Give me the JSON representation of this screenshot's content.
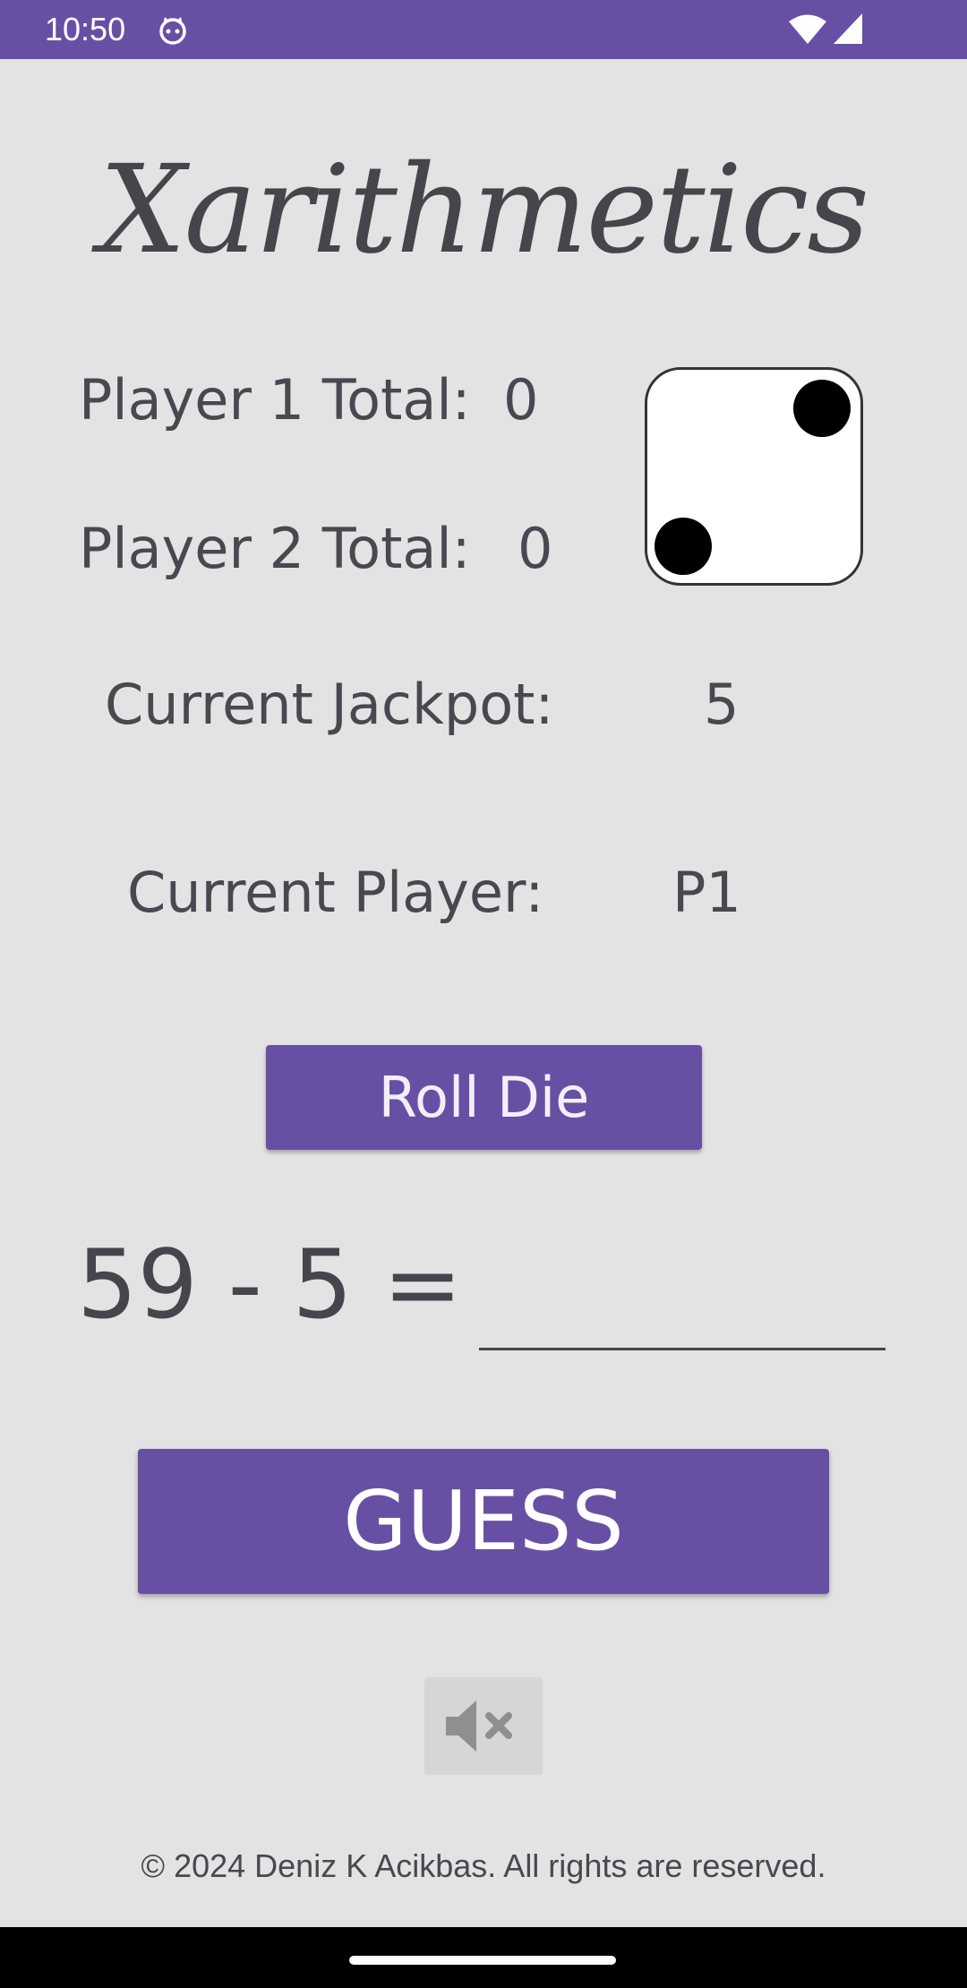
{
  "status_bar": {
    "time": "10:50",
    "app_icon": "android-cat-icon",
    "wifi_icon": "wifi-icon",
    "signal_icon": "cell-signal-icon",
    "background": "#6750a4"
  },
  "title": "Xarithmetics",
  "scores": {
    "player1_label": "Player 1 Total:",
    "player1_value": "0",
    "player2_label": "Player 2 Total:",
    "player2_value": "0"
  },
  "die": {
    "face_value": 2
  },
  "jackpot": {
    "label": "Current Jackpot:",
    "value": "5"
  },
  "current_player": {
    "label": "Current Player:",
    "value": "P1"
  },
  "roll_button_label": "Roll Die",
  "equation": {
    "text": "59 - 5 =",
    "answer_value": ""
  },
  "guess_button_label": "GUESS",
  "mute_button_icon": "volume-mute-icon",
  "copyright": "© 2024 Deniz K Acikbas. All rights are reserved.",
  "colors": {
    "accent": "#6750a4",
    "background": "#e3e3e3",
    "text": "#47444c"
  }
}
